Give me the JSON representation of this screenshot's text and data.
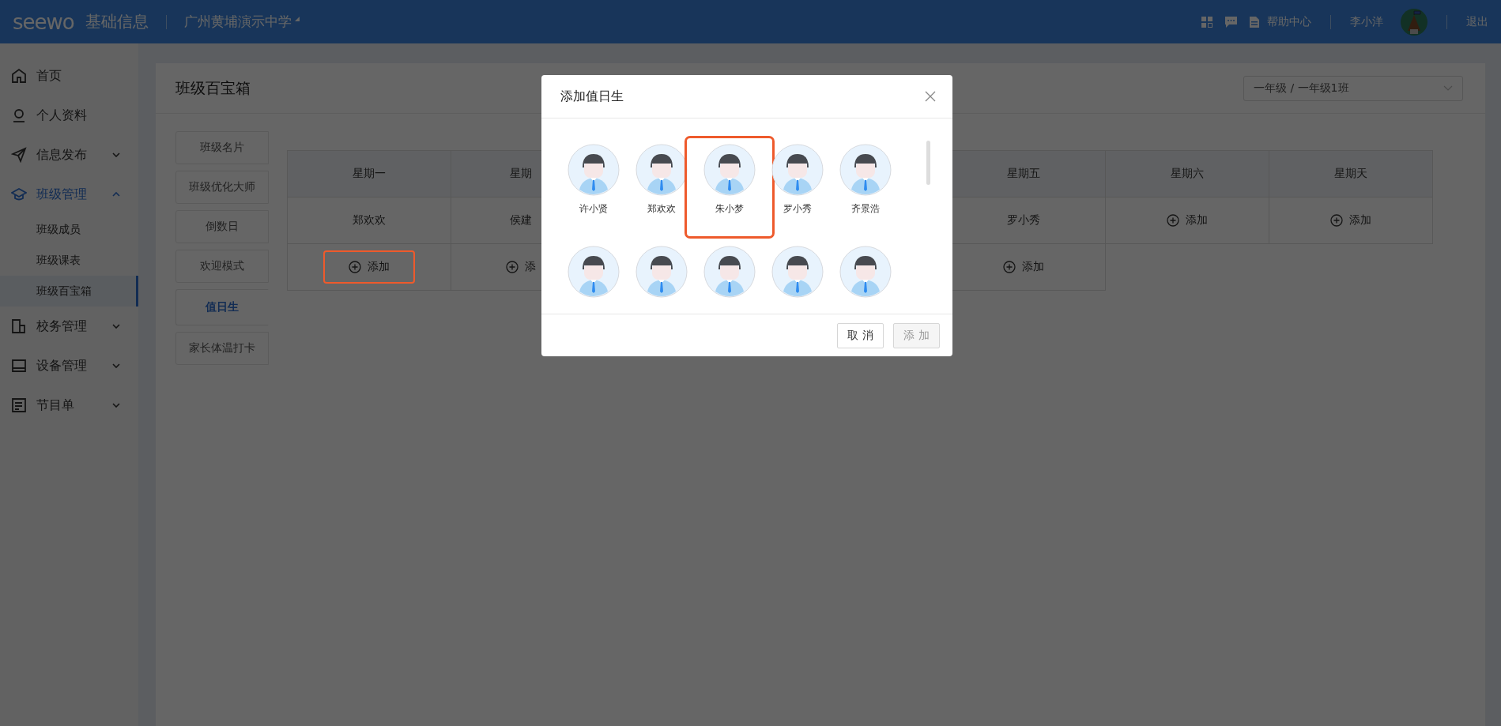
{
  "topbar": {
    "logo": "seewo",
    "product": "基础信息",
    "school": "广州黄埔演示中学",
    "help": "帮助中心",
    "user": "李小洋",
    "logout": "退出"
  },
  "sidebar": {
    "items": [
      {
        "label": "首页",
        "active": false
      },
      {
        "label": "个人资料",
        "active": false
      },
      {
        "label": "信息发布",
        "expanded": false,
        "active": false,
        "expandable": true
      },
      {
        "label": "班级管理",
        "expanded": true,
        "active": true,
        "expandable": true,
        "children": [
          {
            "label": "班级成员",
            "selected": false
          },
          {
            "label": "班级课表",
            "selected": false
          },
          {
            "label": "班级百宝箱",
            "selected": true
          }
        ]
      },
      {
        "label": "校务管理",
        "expanded": false,
        "active": false,
        "expandable": true
      },
      {
        "label": "设备管理",
        "expanded": false,
        "active": false,
        "expandable": true
      },
      {
        "label": "节目单",
        "expanded": false,
        "active": false,
        "expandable": true
      }
    ]
  },
  "page": {
    "title": "班级百宝箱",
    "class_select": "一年级 / 一年级1班"
  },
  "tabs": [
    {
      "label": "班级名片",
      "selected": false
    },
    {
      "label": "班级优化大师",
      "selected": false
    },
    {
      "label": "倒数日",
      "selected": false
    },
    {
      "label": "欢迎模式",
      "selected": false
    },
    {
      "label": "值日生",
      "selected": true
    },
    {
      "label": "家长体温打卡",
      "selected": false
    }
  ],
  "table": {
    "columns": [
      "星期一",
      "星期",
      null,
      null,
      "星期五",
      "星期六",
      "星期天"
    ],
    "rows": [
      {
        "cells": [
          {
            "kind": "name",
            "text": "郑欢欢"
          },
          {
            "kind": "name",
            "text": "侯建"
          },
          null,
          null,
          {
            "kind": "name",
            "text": "罗小秀"
          },
          {
            "kind": "add",
            "text": "添加",
            "highlighted": false
          },
          {
            "kind": "add",
            "text": "添加",
            "highlighted": false
          }
        ]
      },
      {
        "cells": [
          {
            "kind": "add",
            "text": "添加",
            "highlighted": true
          },
          {
            "kind": "add",
            "text": "添",
            "highlighted": false
          },
          null,
          null,
          {
            "kind": "add",
            "text": "添加",
            "highlighted": false
          }
        ]
      }
    ]
  },
  "dialog": {
    "title": "添加值日生",
    "students": [
      {
        "name": "许小贤",
        "highlighted": false
      },
      {
        "name": "郑欢欢",
        "highlighted": false
      },
      {
        "name": "朱小梦",
        "highlighted": true
      },
      {
        "name": "罗小秀",
        "highlighted": false
      },
      {
        "name": "齐景浩",
        "highlighted": false
      },
      {
        "highlighted": false
      },
      {
        "highlighted": false
      },
      {
        "highlighted": false
      },
      {
        "highlighted": false
      },
      {
        "highlighted": false
      }
    ],
    "buttons": [
      {
        "label": "取 消",
        "disabled": false
      },
      {
        "label": "添 加",
        "disabled": true
      }
    ]
  }
}
